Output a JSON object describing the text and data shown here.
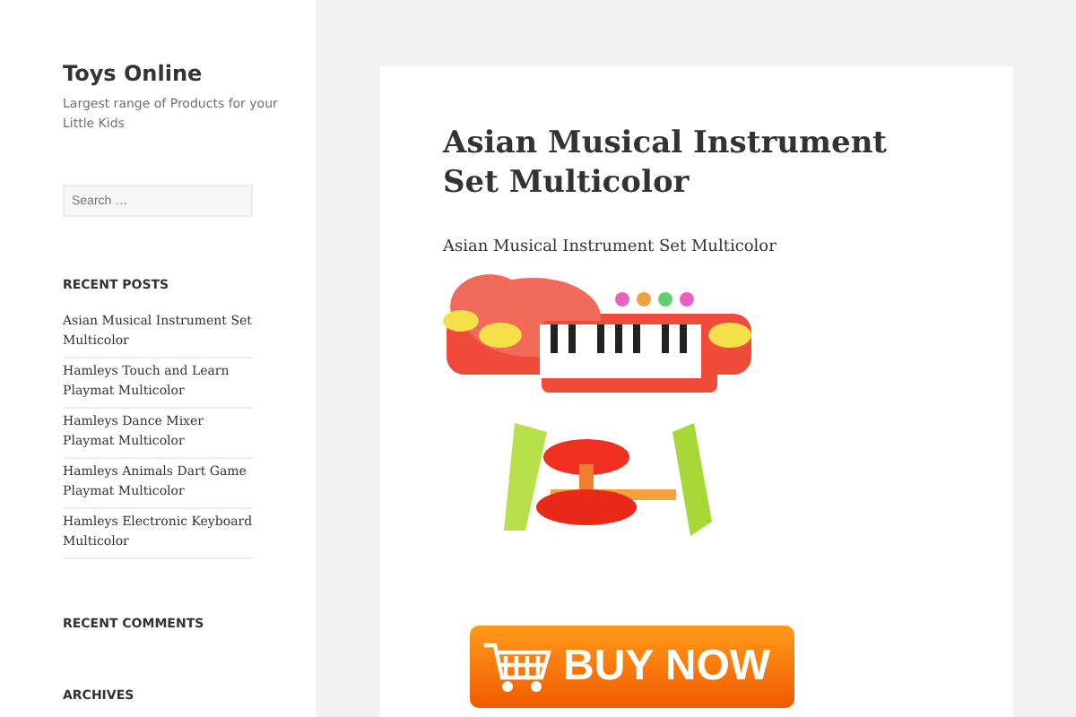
{
  "site": {
    "title": "Toys Online",
    "tagline": "Largest range of Products for your Little Kids"
  },
  "search": {
    "placeholder": "Search …"
  },
  "sidebar": {
    "widgets": [
      {
        "heading": "RECENT POSTS",
        "items": [
          "Asian Musical Instrument Set Multicolor",
          "Hamleys Touch and Learn Playmat Multicolor",
          "Hamleys Dance Mixer Playmat Multicolor",
          "Hamleys Animals Dart Game Playmat Multicolor",
          "Hamleys Electronic Keyboard Multicolor"
        ]
      },
      {
        "heading": "RECENT COMMENTS"
      },
      {
        "heading": "ARCHIVES"
      }
    ]
  },
  "post": {
    "title": "Asian Musical Instrument Set Multicolor",
    "text": "Asian Musical Instrument Set Multicolor",
    "buy_button": "BUY NOW"
  }
}
